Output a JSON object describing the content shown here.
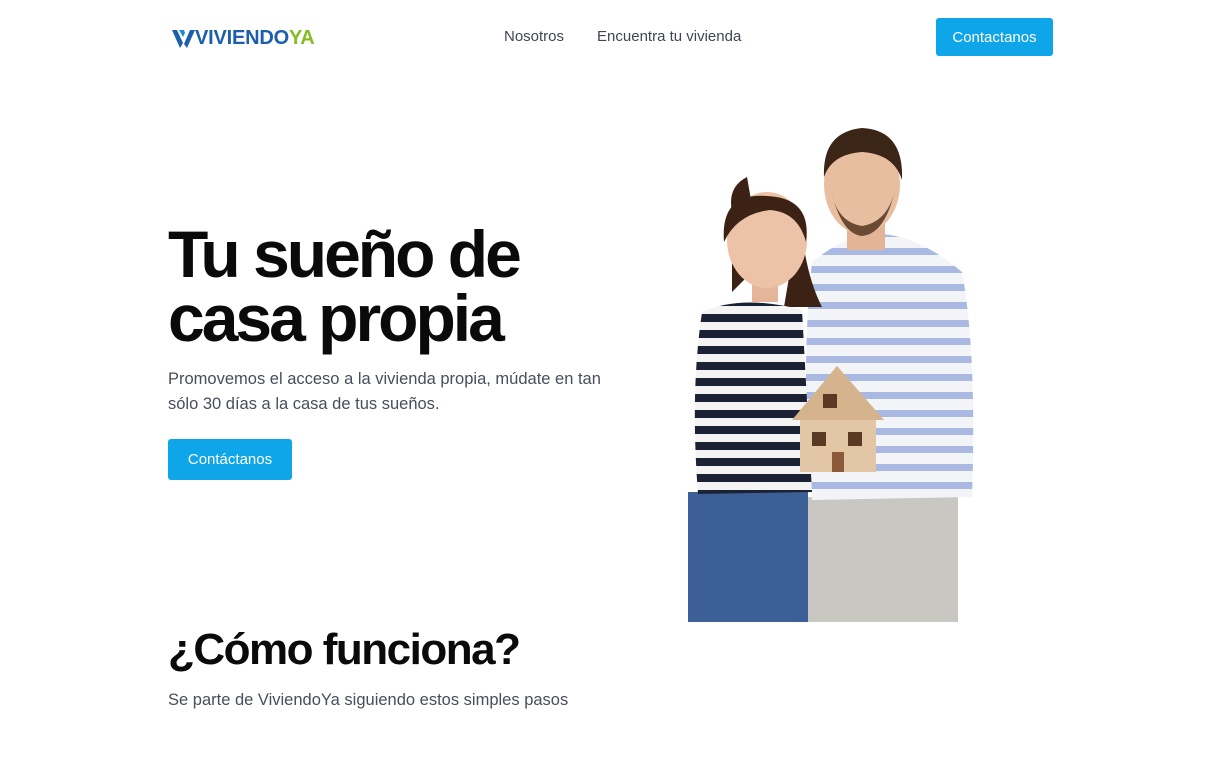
{
  "header": {
    "logo_part1": "VIVIENDO",
    "logo_part2": "YA",
    "nav": [
      "Nosotros",
      "Encuentra tu vivienda"
    ],
    "cta_label": "Contactanos"
  },
  "hero": {
    "title_line1": "Tu sueño de",
    "title_line2": "casa propia",
    "subtitle": "Promovemos el acceso a la vivienda propia, múdate en tan sólo 30 días a la casa de tus sueños.",
    "cta_label": "Contáctanos",
    "image": "couple-holding-house-model"
  },
  "how": {
    "title": "¿Cómo funciona?",
    "subtitle": "Se parte de ViviendoYa siguiendo estos simples pasos"
  },
  "colors": {
    "accent": "#0ea5e9",
    "brand_blue": "#1b5fad",
    "brand_green": "#86bc25",
    "text_muted": "#474e5c"
  }
}
